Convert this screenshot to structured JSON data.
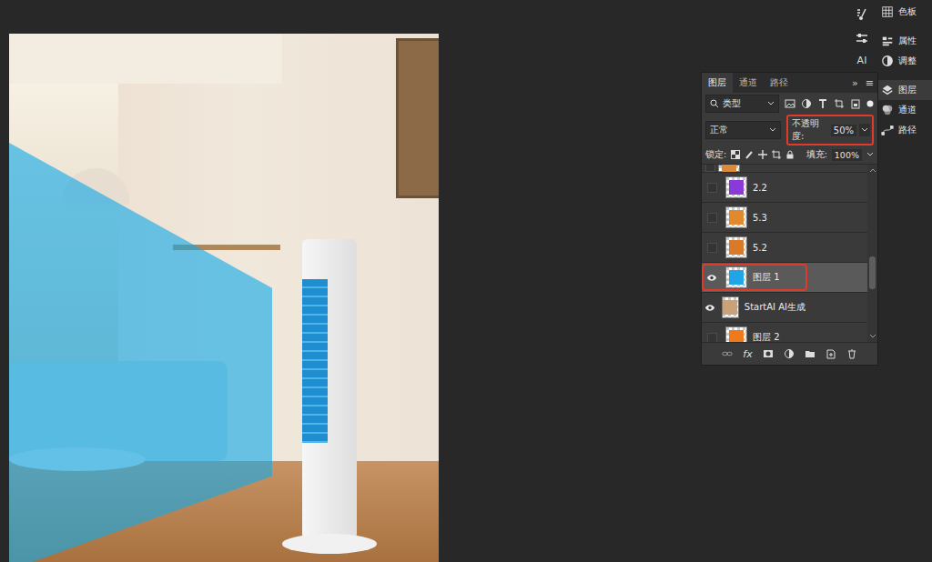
{
  "layers_panel": {
    "tabs": [
      {
        "label": "图层",
        "selected": true
      },
      {
        "label": "通道",
        "selected": false
      },
      {
        "label": "路径",
        "selected": false
      }
    ],
    "overflow": "»",
    "menu": "≡",
    "filter": {
      "label": "类型"
    },
    "blend_mode": "正常",
    "opacity": {
      "label": "不透明度:",
      "value": "50%",
      "highlighted": true
    },
    "lock": {
      "label": "锁定:"
    },
    "fill": {
      "label": "填充:",
      "value": "100%"
    },
    "layers": [
      {
        "name": "2.2",
        "visible": false,
        "selected": false,
        "highlighted": false,
        "color": "#8a3ad6"
      },
      {
        "name": "5.3",
        "visible": false,
        "selected": false,
        "highlighted": false,
        "color": "#e0892e"
      },
      {
        "name": "5.2",
        "visible": false,
        "selected": false,
        "highlighted": false,
        "color": "#d97a2a"
      },
      {
        "name": "图层 1",
        "visible": true,
        "selected": true,
        "highlighted": true,
        "color": "#1ea6e6"
      },
      {
        "name": "StartAI AI生成",
        "visible": true,
        "selected": false,
        "highlighted": false,
        "color": "#c9a27a"
      },
      {
        "name": "图层 2",
        "visible": false,
        "selected": false,
        "highlighted": false,
        "color": "#f07a1a"
      }
    ],
    "bottom_fx": "fx"
  },
  "tool_strip": {
    "ai_label": "AI"
  },
  "dock": [
    {
      "label": "色板",
      "selected": false
    },
    {
      "label": "属性",
      "selected": false
    },
    {
      "label": "调整",
      "selected": false
    },
    {
      "label": "图层",
      "selected": true
    },
    {
      "label": "通道",
      "selected": false
    },
    {
      "label": "路径",
      "selected": false
    }
  ]
}
